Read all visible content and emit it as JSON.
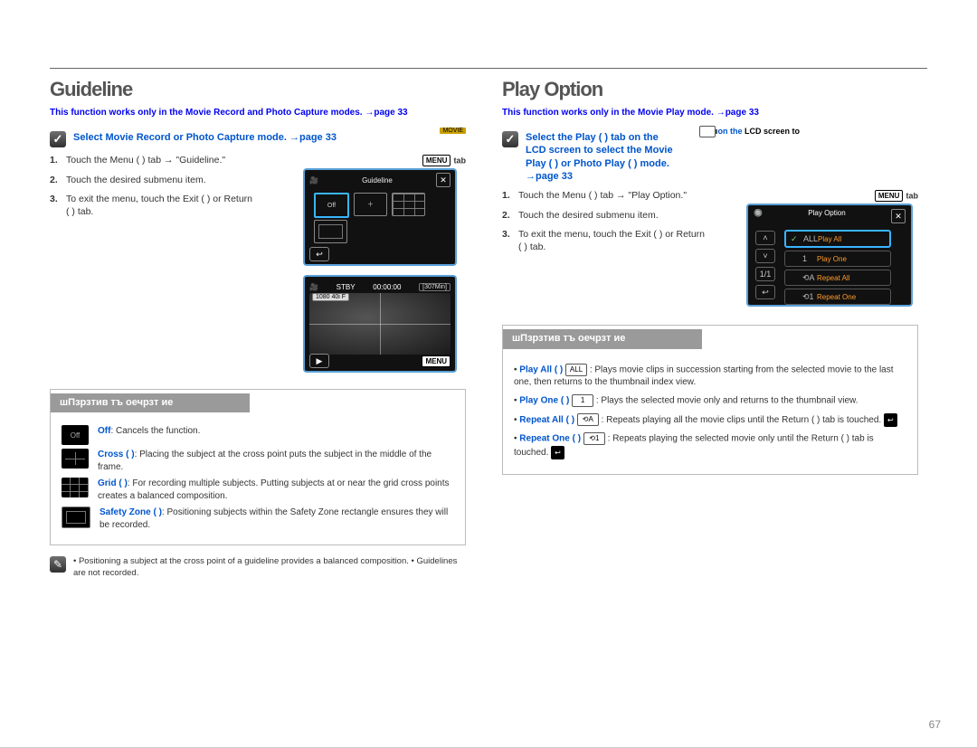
{
  "pagenum": "67",
  "left": {
    "title": "Guideline",
    "intro": "This function works only in the Movie Record and Photo Capture modes. →page 33",
    "precheck": "Select Movie Record or Photo Capture mode. →page 33",
    "mov": "MOVIE",
    "steps": {
      "s1": "Touch the Menu ( ) tab → \"Guideline.\"",
      "s2": "Touch the desired submenu item.",
      "s3": "To exit the menu, touch the Exit ( ) or Return ( ) tab."
    },
    "menuTab": "MENU",
    "shot1": {
      "title": "Guideline",
      "off": "Off"
    },
    "shot2": {
      "stby": "STBY",
      "time": "00:00:00",
      "rem": "[307Min]",
      "res": "1080 40i F"
    },
    "items": {
      "heading": "шПзрзтив тъ оечрзт ие",
      "off": {
        "label": "Off",
        "desc": ": Cancels the function."
      },
      "cross": {
        "label": "Cross ( )",
        "desc": ": Placing the subject at the cross point puts the subject in the middle of the frame."
      },
      "grid": {
        "label": "Grid ( )",
        "desc": ": For recording multiple subjects. Putting subjects at or near the grid cross points creates a balanced composition."
      },
      "safe": {
        "label": "Safety Zone ( )",
        "desc": ": Positioning subjects within the Safety Zone rectangle ensures they will be recorded."
      }
    },
    "footnote": "• Positioning a subject at the cross point of a guideline provides a balanced composition.\n• Guidelines are not recorded."
  },
  "right": {
    "title": "Play Option",
    "intro": "This function works only in the Movie Play mode. →page 33",
    "precheck": "Select the Play ( ) tab on the LCD screen to select the Movie Play ( ) or Photo Play ( ) mode. →page 33",
    "steps": {
      "s1": "Touch the Menu ( ) tab → \"Play Option.\"",
      "s2": "Touch the desired submenu item.",
      "s3": "To exit the menu, touch the Exit ( ) or Return ( ) tab."
    },
    "shot": {
      "title": "Play Option",
      "opts": [
        "Play All",
        "Play One",
        "Repeat All",
        "Repeat One"
      ]
    },
    "items": {
      "heading": "шПзрзтив тъ оечрзт ие",
      "all": {
        "label": "Play All ( )",
        "desc": ": Plays movie clips in succession starting from the selected movie to the last one, then returns to the thumbnail index view."
      },
      "one": {
        "label": "Play One ( )",
        "desc": ": Plays the selected movie only and returns to the thumbnail view."
      },
      "repall": {
        "label": "Repeat All ( )",
        "desc": ": Repeats playing all the movie clips until the Return ( ) tab is touched."
      },
      "repone": {
        "label": "Repeat One ( )",
        "desc": ": Repeats playing the selected movie only until the Return ( ) tab is touched."
      }
    }
  }
}
